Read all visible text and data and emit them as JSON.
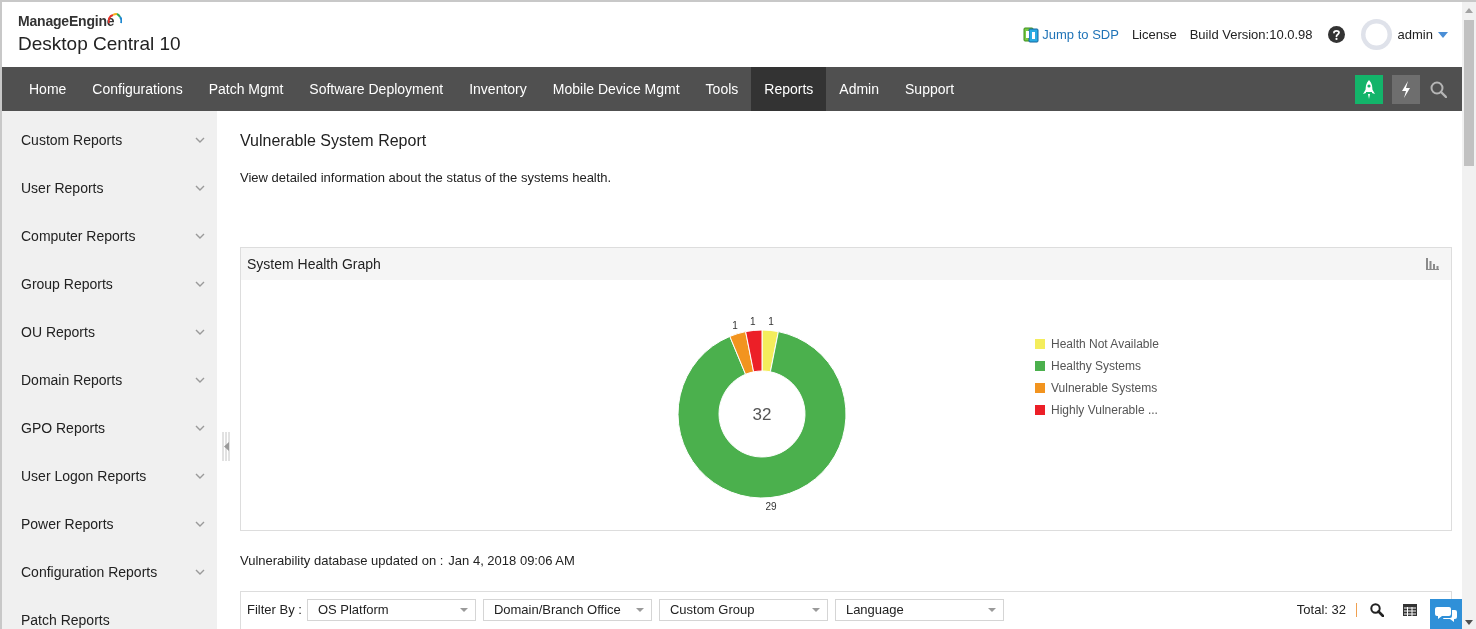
{
  "header": {
    "brand": "ManageEngine",
    "product": "Desktop Central 10",
    "links": [
      {
        "label": "Jump to SDP",
        "kind": "sdp"
      },
      {
        "label": "License",
        "kind": "plain"
      }
    ],
    "build_version": "Build Version:10.0.98",
    "user": "admin"
  },
  "nav": {
    "items": [
      {
        "label": "Home",
        "selected": false
      },
      {
        "label": "Configurations",
        "selected": false
      },
      {
        "label": "Patch Mgmt",
        "selected": false
      },
      {
        "label": "Software Deployment",
        "selected": false
      },
      {
        "label": "Inventory",
        "selected": false
      },
      {
        "label": "Mobile Device Mgmt",
        "selected": false
      },
      {
        "label": "Tools",
        "selected": false
      },
      {
        "label": "Reports",
        "selected": true
      },
      {
        "label": "Admin",
        "selected": false
      },
      {
        "label": "Support",
        "selected": false
      }
    ]
  },
  "sidebar": {
    "items": [
      {
        "label": "Custom Reports",
        "expanded": false
      },
      {
        "label": "User Reports",
        "expanded": false
      },
      {
        "label": "Computer Reports",
        "expanded": false
      },
      {
        "label": "Group Reports",
        "expanded": false
      },
      {
        "label": "OU Reports",
        "expanded": false
      },
      {
        "label": "Domain Reports",
        "expanded": false
      },
      {
        "label": "GPO Reports",
        "expanded": false
      },
      {
        "label": "User Logon Reports",
        "expanded": false
      },
      {
        "label": "Power Reports",
        "expanded": false
      },
      {
        "label": "Configuration Reports",
        "expanded": false
      },
      {
        "label": "Patch Reports"
      }
    ]
  },
  "page": {
    "title": "Vulnerable System Report",
    "description": "View detailed information about the status of the systems health."
  },
  "system_health": {
    "title": "System Health Graph",
    "center_label": "32",
    "chart_data": {
      "type": "donut",
      "categories": [
        "Health Not Available",
        "Healthy Systems",
        "Vulnerable Systems",
        "Highly Vulnerable ..."
      ],
      "values": [
        1,
        29,
        1,
        1
      ],
      "colors": [
        "#f4ed5c",
        "#4bb04d",
        "#f2941f",
        "#ec1f27"
      ],
      "data_labels": true,
      "legend": "right"
    }
  },
  "update_info": {
    "label": "Vulnerability database updated on :",
    "value": "Jan 4, 2018 09:06 AM"
  },
  "filter_bar": {
    "label": "Filter By :",
    "filters": [
      {
        "value": "OS Platform"
      },
      {
        "value": "Domain/Branch Office"
      },
      {
        "value": "Custom Group"
      },
      {
        "value": "Language"
      }
    ],
    "total": "Total: 32"
  }
}
